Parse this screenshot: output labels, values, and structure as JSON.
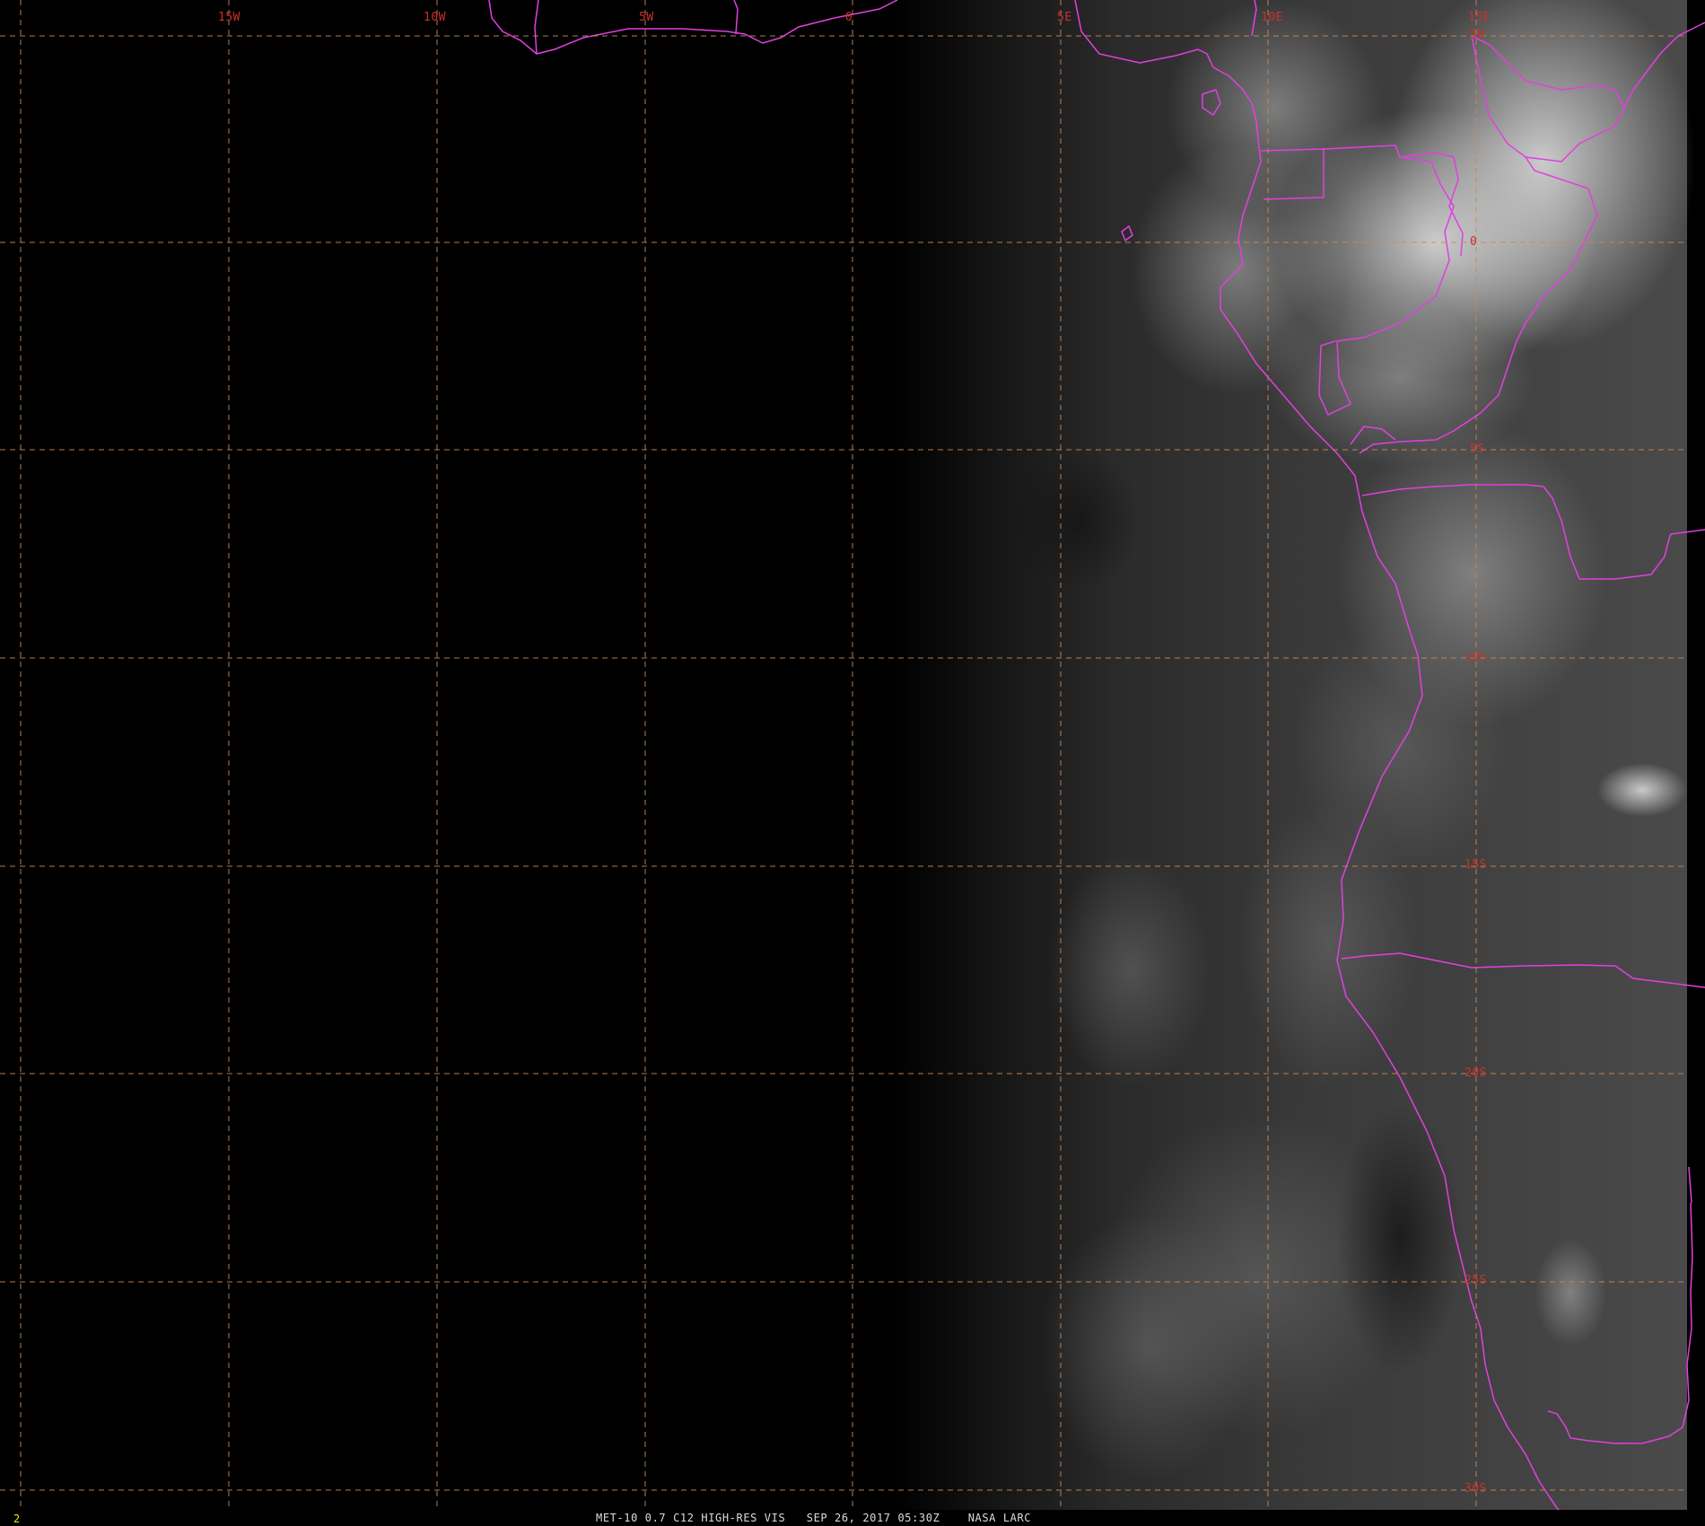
{
  "image": {
    "frame_number": "2",
    "caption": "MET-10 0.7 C12 HIGH-RES VIS   SEP 26, 2017 05:30Z    NASA LARC"
  },
  "grid": {
    "color": "#c88a58",
    "longitude_labels": [
      "15W",
      "10W",
      "5W",
      "0",
      "5E",
      "10E",
      "15E"
    ],
    "latitude_labels": [
      "5N",
      "0",
      "5S",
      "10S",
      "15S",
      "20S",
      "25S",
      "30S"
    ]
  },
  "colors": {
    "label": "#c8322c",
    "boundaries": "#e040e0",
    "frame_number": "#e8e800",
    "caption": "#dcdcdc"
  }
}
